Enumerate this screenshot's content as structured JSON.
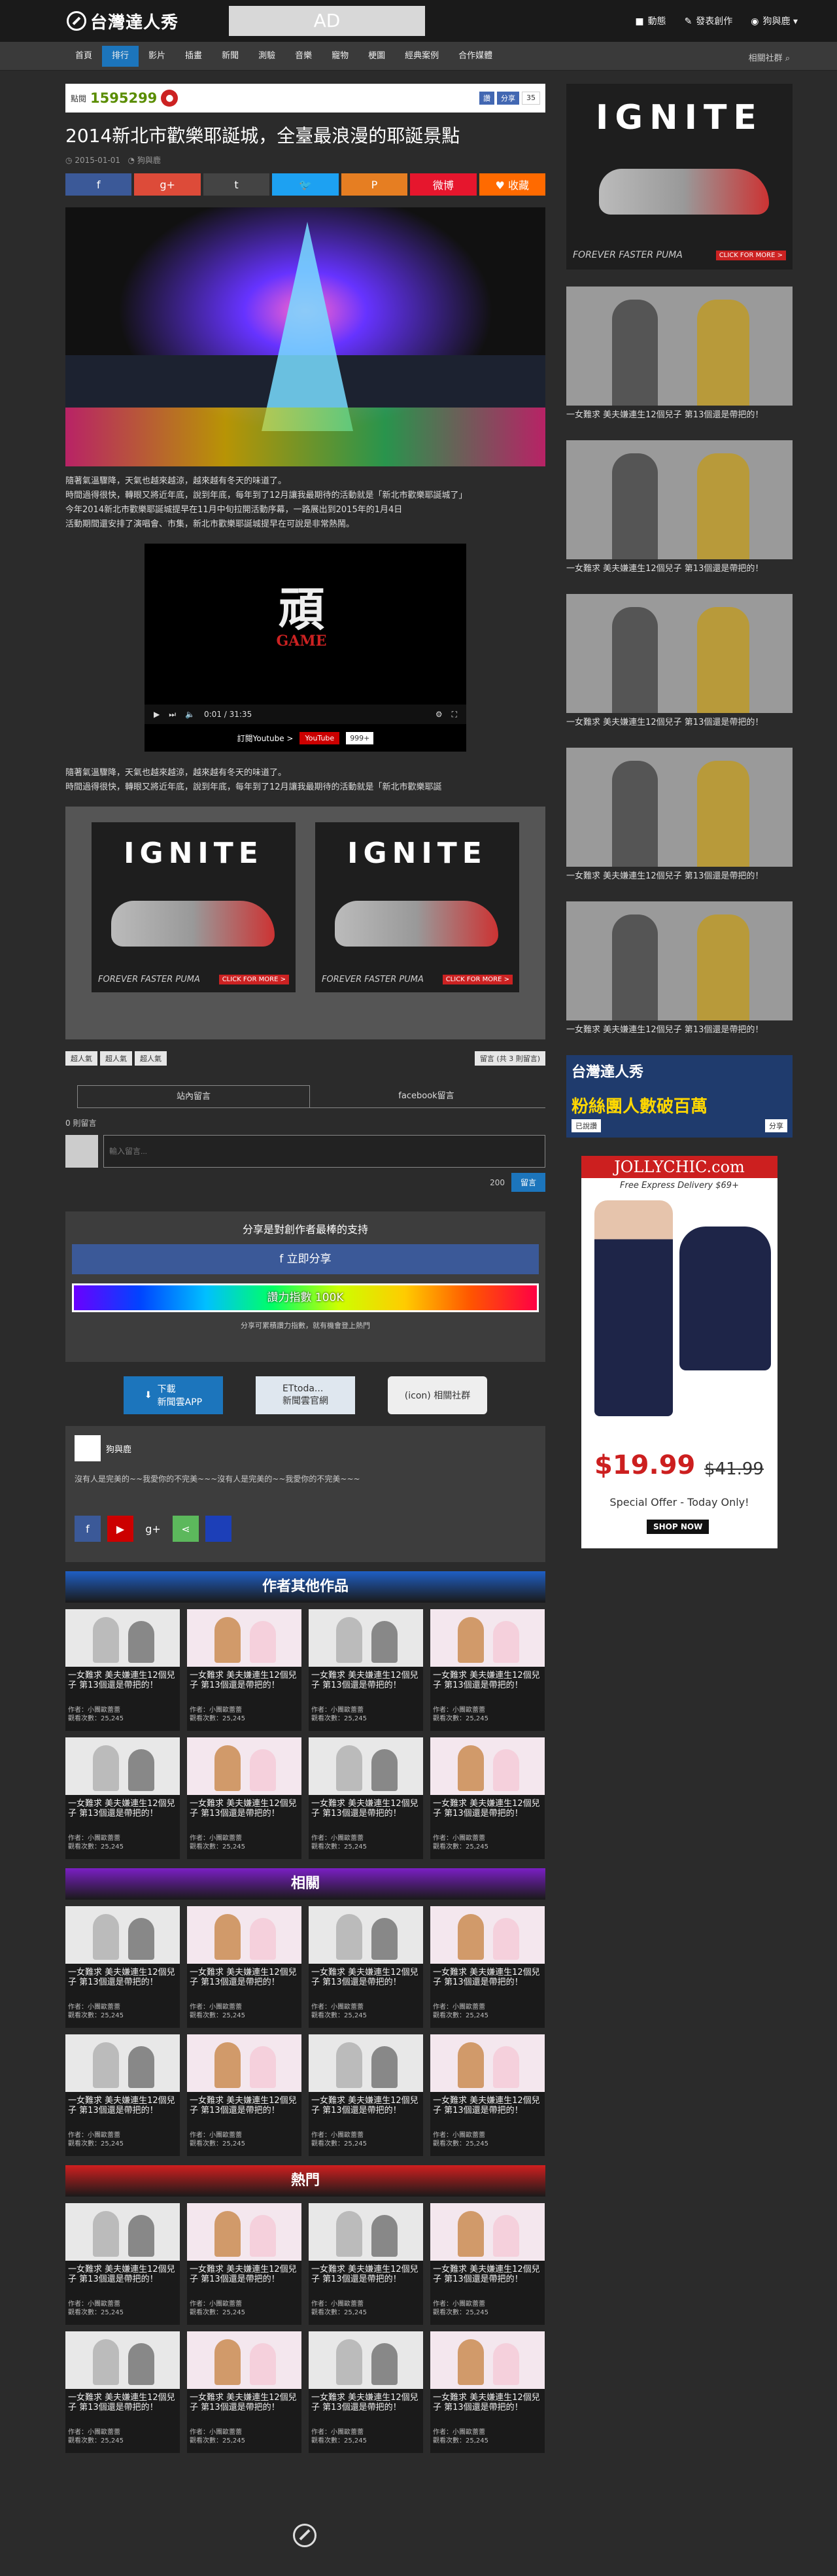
{
  "header": {
    "logo_text": "台灣達人秀",
    "ad_label": "AD",
    "nav_right": [
      {
        "icon": "bell-icon",
        "label": "動態"
      },
      {
        "icon": "pencil-icon",
        "label": "發表創作"
      },
      {
        "icon": "user-icon",
        "label": "狗與鹿"
      }
    ]
  },
  "nav": {
    "items": [
      "首頁",
      "排行",
      "影片",
      "插畫",
      "新聞",
      "測驗",
      "音樂",
      "寵物",
      "梗圖",
      "經典案例",
      "合作媒體"
    ],
    "active_index": 1,
    "search_label": "相關社群"
  },
  "article": {
    "view_label": "點閱",
    "views": "1595299",
    "fb_like": "讚",
    "fb_share": "分享",
    "fb_count": "35",
    "title": "2014新北市歡樂耶誕城，全臺最浪漫的耶誕景點",
    "date": "2015-01-01",
    "meta_extra": "狗與鹿",
    "share_buttons": [
      {
        "label": "f",
        "color": "#3b5998"
      },
      {
        "label": "g+",
        "color": "#dd4b39"
      },
      {
        "label": "t",
        "color": "#444"
      },
      {
        "label": "🐦",
        "color": "#1da1f2"
      },
      {
        "label": "P",
        "color": "#e67e22"
      },
      {
        "label": "微博",
        "color": "#e6162d"
      },
      {
        "label": "♥ 收藏",
        "color": "#ff6a00"
      }
    ],
    "body1": "隨著氣溫驟降，天氣也越來越涼，越來越有冬天的味道了。\n時間過得很快，轉眼又將近年底，說到年底，每年到了12月讓我最期待的活動就是「新北市歡樂耶誕城了」\n今年2014新北市歡樂耶誕城提早在11月中旬拉開活動序幕，一路展出到2015年的1月4日\n活動期間還安排了演唱會、市集，新北市歡樂耶誕城提早在可說是非常熱鬧。",
    "video": {
      "art_text": "頑",
      "art_sub": "GAME",
      "time": "0:01 / 31:35",
      "subscribe": "訂閱Youtube >",
      "yt_label": "YouTube",
      "yt_count": "999+"
    },
    "body2": "隨著氣溫驟降，天氣也越來越涼，越來越有冬天的味道了。\n時間過得很快，轉眼又將近年底，說到年底，每年到了12月讓我最期待的活動就是「新北市歡樂耶誕",
    "ads": [
      {
        "brand": "IGNITE",
        "tagline": "FOREVER FASTER PUMA",
        "cta": "CLICK FOR MORE >"
      },
      {
        "brand": "IGNITE",
        "tagline": "FOREVER FASTER PUMA",
        "cta": "CLICK FOR MORE >"
      }
    ],
    "tags": [
      "超人氣",
      "超人氣",
      "超人氣"
    ],
    "comment_count_btn": "留言 (共 3 則留言)"
  },
  "comments": {
    "tabs": [
      "站內留言",
      "facebook留言"
    ],
    "count_label": "0 則留言",
    "placeholder": "輸入留言...",
    "char_limit": "200",
    "submit": "留言"
  },
  "support": {
    "title": "分享是對創作者最棒的支持",
    "fb_share": "f 立即分享",
    "power_label": "讚力指數  100K",
    "note": "分享可累積讚力指數，就有機會登上熱門"
  },
  "apps": [
    {
      "label": "下載\n新聞雲APP"
    },
    {
      "label": "ETtoda...\n新聞雲官網"
    },
    {
      "label": "(icon) 相關社群"
    }
  ],
  "author": {
    "name": "狗與鹿",
    "bio": "沒有人是完美的~~我愛你的不完美~~~沒有人是完美的~~我愛你的不完美~~~",
    "socials": [
      {
        "icon": "facebook-icon",
        "label": "f",
        "color": "#3b5998"
      },
      {
        "icon": "youtube-icon",
        "label": "▶",
        "color": "#cc0000"
      },
      {
        "icon": "googleplus-icon",
        "label": "g+",
        "color": "#3d3d3d"
      },
      {
        "icon": "share-icon",
        "label": "⋖",
        "color": "#5cb85c"
      },
      {
        "icon": "blog-icon",
        "label": "",
        "color": "#1c3fb8"
      }
    ]
  },
  "sections": [
    {
      "title": "作者其他作品",
      "color": "#1f5fc4"
    },
    {
      "title": "相關",
      "color": "#7a1fc4"
    },
    {
      "title": "熱門",
      "color": "#d11f1f"
    }
  ],
  "card": {
    "title": "一女難求 美夫嫌連生12個兒子 第13個還是帶把的！",
    "author": "作者：小團歐蕾蕾",
    "views": "觀看次數：25,245"
  },
  "sidebar": {
    "ad": {
      "brand": "IGNITE",
      "tagline": "FOREVER FASTER PUMA",
      "cta": "CLICK FOR MORE >"
    },
    "items": [
      "一女難求 美夫嫌連生12個兒子 第13個還是帶把的！",
      "一女難求 美夫嫌連生12個兒子 第13個還是帶把的！",
      "一女難求 美夫嫌連生12個兒子 第13個還是帶把的！",
      "一女難求 美夫嫌連生12個兒子 第13個還是帶把的！",
      "一女難求 美夫嫌連生12個兒子 第13個還是帶把的！"
    ],
    "banner": {
      "line1": "台灣達人秀",
      "line2": "粉絲團人數破百萬",
      "btn1": "已說讚",
      "btn2": "分享"
    },
    "jolly": {
      "brand": "JOLLYCHIC.com",
      "sub": "Free Express Delivery $69+",
      "price": "$19.99",
      "price_old": "$41.99",
      "offer": "Special Offer - Today Only!",
      "shop": "SHOP NOW"
    }
  }
}
